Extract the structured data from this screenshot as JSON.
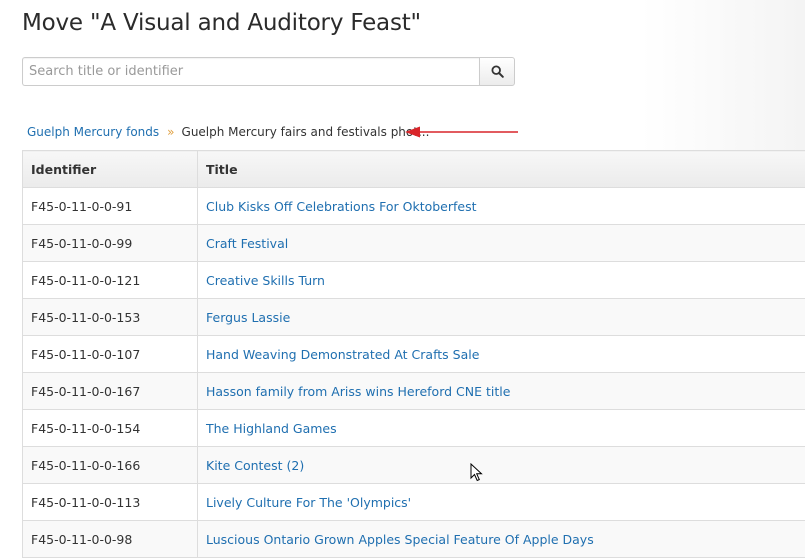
{
  "page": {
    "title": "Move \"A Visual and Auditory Feast\""
  },
  "search": {
    "placeholder": "Search title or identifier",
    "value": "",
    "button_icon": "search-icon"
  },
  "breadcrumb": {
    "parent_label": "Guelph Mercury fonds",
    "separator": "»",
    "current_label": "Guelph Mercury fairs and festivals phot..."
  },
  "annotation": {
    "arrow_color": "#d9252a"
  },
  "colors": {
    "link": "#1f6fb0",
    "breadcrumb_separator": "#e0a040"
  },
  "table": {
    "columns": [
      "Identifier",
      "Title"
    ],
    "rows": [
      {
        "identifier": "F45-0-11-0-0-91",
        "title": "Club Kisks Off Celebrations For Oktoberfest"
      },
      {
        "identifier": "F45-0-11-0-0-99",
        "title": "Craft Festival"
      },
      {
        "identifier": "F45-0-11-0-0-121",
        "title": "Creative Skills Turn"
      },
      {
        "identifier": "F45-0-11-0-0-153",
        "title": "Fergus Lassie"
      },
      {
        "identifier": "F45-0-11-0-0-107",
        "title": "Hand Weaving Demonstrated At Crafts Sale"
      },
      {
        "identifier": "F45-0-11-0-0-167",
        "title": "Hasson family from Ariss wins Hereford CNE title"
      },
      {
        "identifier": "F45-0-11-0-0-154",
        "title": "The Highland Games"
      },
      {
        "identifier": "F45-0-11-0-0-166",
        "title": "Kite Contest (2)"
      },
      {
        "identifier": "F45-0-11-0-0-113",
        "title": "Lively Culture For The 'Olympics'"
      },
      {
        "identifier": "F45-0-11-0-0-98",
        "title": "Luscious Ontario Grown Apples Special Feature Of Apple Days"
      }
    ]
  }
}
